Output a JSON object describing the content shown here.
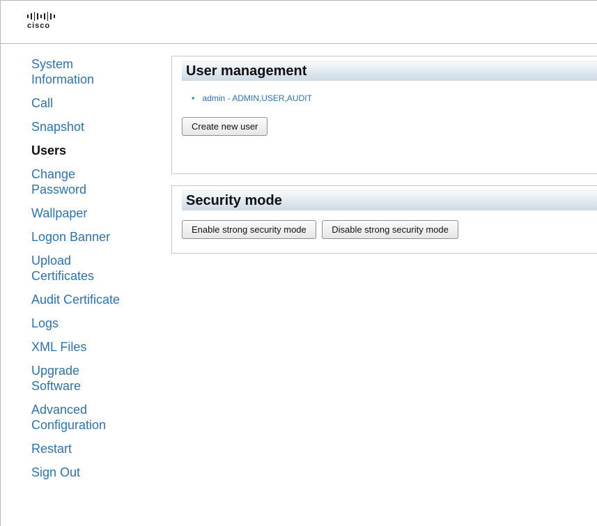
{
  "brand": {
    "name": "cisco",
    "icon": "cisco-logo-icon"
  },
  "nav": {
    "items": [
      {
        "label": "System\nInformation",
        "active": false
      },
      {
        "label": "Call",
        "active": false
      },
      {
        "label": "Snapshot",
        "active": false
      },
      {
        "label": "Users",
        "active": true
      },
      {
        "label": "Change\nPassword",
        "active": false
      },
      {
        "label": "Wallpaper",
        "active": false
      },
      {
        "label": "Logon Banner",
        "active": false
      },
      {
        "label": "Upload\nCertificates",
        "active": false
      },
      {
        "label": "Audit Certificate",
        "active": false
      },
      {
        "label": "Logs",
        "active": false
      },
      {
        "label": "XML Files",
        "active": false
      },
      {
        "label": "Upgrade\nSoftware",
        "active": false
      },
      {
        "label": "Advanced\nConfiguration",
        "active": false
      },
      {
        "label": "Restart",
        "active": false
      },
      {
        "label": "Sign Out",
        "active": false
      }
    ]
  },
  "user_management": {
    "title": "User management",
    "users": [
      "admin - ADMIN,USER,AUDIT"
    ],
    "create_button": "Create new user"
  },
  "security_mode": {
    "title": "Security mode",
    "enable_button": "Enable strong security mode",
    "disable_button": "Disable strong security mode"
  },
  "colors": {
    "link": "#2b73b7",
    "active_nav": "#111111",
    "panel_header": "#dfe8f0"
  }
}
